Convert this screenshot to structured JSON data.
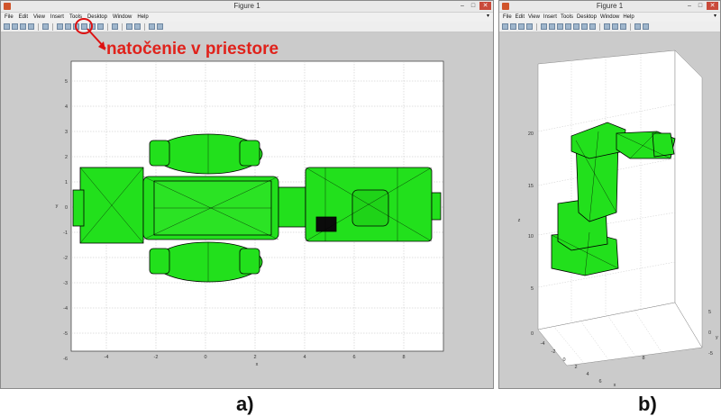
{
  "window_a": {
    "title": "Figure 1",
    "menu": [
      "File",
      "Edit",
      "View",
      "Insert",
      "Tools",
      "Desktop",
      "Window",
      "Help"
    ],
    "menu_arrow": "▾",
    "x_ticks": [
      "-4",
      "-2",
      "0",
      "2",
      "4",
      "6",
      "8"
    ],
    "y_ticks": [
      "5",
      "4",
      "3",
      "2",
      "1",
      "0",
      "-1",
      "-2",
      "-3",
      "-4",
      "-5",
      "-6"
    ],
    "xlabel": "x",
    "ylabel": "y",
    "annotation": "natočenie v priestore",
    "label": "a)"
  },
  "window_b": {
    "title": "Figure 1",
    "menu": [
      "File",
      "Edit",
      "View",
      "Insert",
      "Tools",
      "Desktop",
      "Window",
      "Help"
    ],
    "menu_arrow": "▾",
    "z_ticks": [
      "20",
      "15",
      "10",
      "5",
      "0"
    ],
    "x_ticks": [
      "-4",
      "-2",
      "0",
      "2",
      "4",
      "6",
      "8"
    ],
    "y_ticks": [
      "5",
      "0",
      "-5"
    ],
    "zlabel": "z",
    "xlabel": "x",
    "ylabel": "y",
    "label": "b)"
  },
  "colors": {
    "mesh_fill": "#22e01c",
    "mesh_edge": "#000000",
    "annotation": "#e0221b",
    "canvas": "#cbcbcb"
  }
}
